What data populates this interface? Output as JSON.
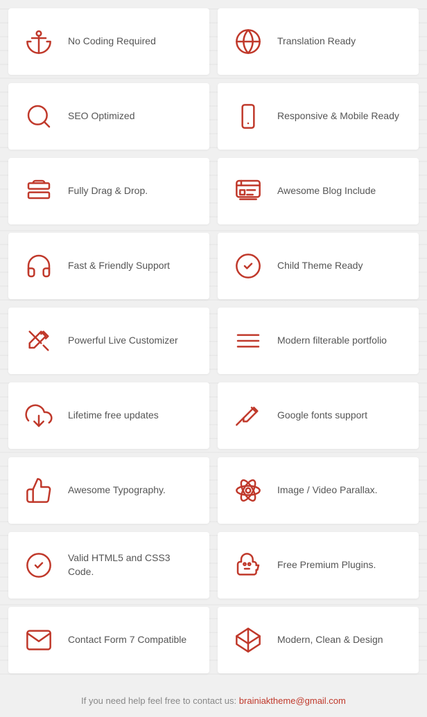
{
  "features": [
    {
      "id": "no-coding",
      "label": "No Coding Required",
      "icon": "anchor"
    },
    {
      "id": "translation",
      "label": "Translation Ready",
      "icon": "globe"
    },
    {
      "id": "seo",
      "label": "SEO Optimized",
      "icon": "search"
    },
    {
      "id": "responsive",
      "label": "Responsive & Mobile Ready",
      "icon": "mobile"
    },
    {
      "id": "drag-drop",
      "label": "Fully Drag & Drop.",
      "icon": "layers"
    },
    {
      "id": "blog",
      "label": "Awesome Blog Include",
      "icon": "blog"
    },
    {
      "id": "support",
      "label": "Fast & Friendly Support",
      "icon": "headphones"
    },
    {
      "id": "child-theme",
      "label": "Child Theme Ready",
      "icon": "checkmark"
    },
    {
      "id": "customizer",
      "label": "Powerful Live Customizer",
      "icon": "tools"
    },
    {
      "id": "portfolio",
      "label": "Modern filterable portfolio",
      "icon": "menu-lines"
    },
    {
      "id": "updates",
      "label": "Lifetime free updates",
      "icon": "cloud-download"
    },
    {
      "id": "fonts",
      "label": "Google fonts support",
      "icon": "pencil"
    },
    {
      "id": "typography",
      "label": "Awesome Typography.",
      "icon": "thumbs-up"
    },
    {
      "id": "parallax",
      "label": "Image / Video Parallax.",
      "icon": "atom"
    },
    {
      "id": "html5",
      "label": "Valid HTML5 and CSS3 Code.",
      "icon": "circle-check"
    },
    {
      "id": "plugins",
      "label": "Free Premium Plugins.",
      "icon": "piggy-bank"
    },
    {
      "id": "contact-form",
      "label": "Contact Form 7 Compatible",
      "icon": "envelope"
    },
    {
      "id": "design",
      "label": "Modern, Clean & Design",
      "icon": "diamond"
    }
  ],
  "footer": {
    "text": "If you need help feel free to contact us:",
    "email": "brainiaktheme@gmail.com",
    "email_href": "mailto:brainiaktheme@gmail.com"
  }
}
